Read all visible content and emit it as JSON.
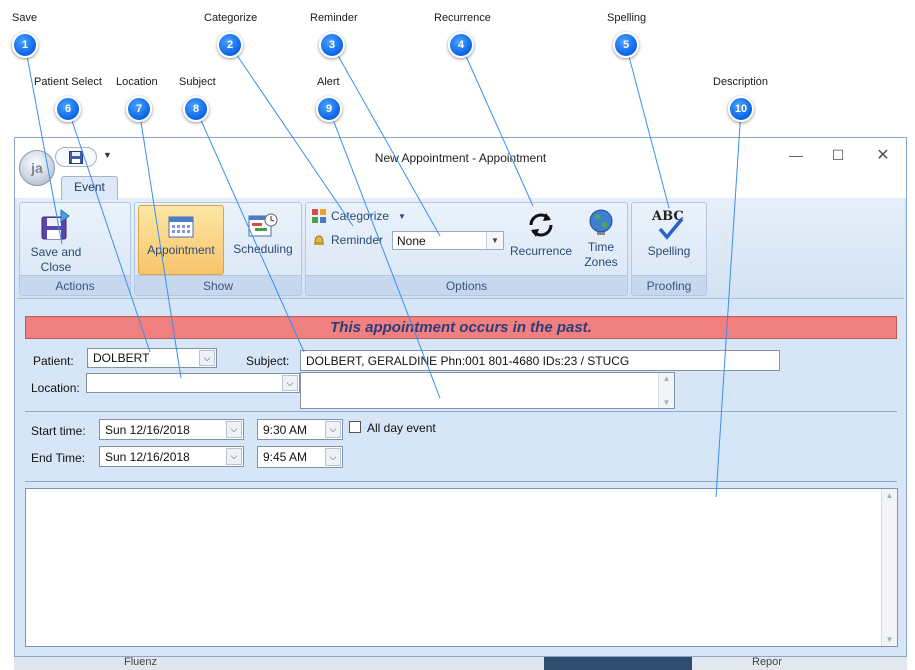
{
  "callouts": [
    {
      "n": "1",
      "label": "Save"
    },
    {
      "n": "2",
      "label": "Categorize"
    },
    {
      "n": "3",
      "label": "Reminder"
    },
    {
      "n": "4",
      "label": "Recurrence"
    },
    {
      "n": "5",
      "label": "Spelling"
    },
    {
      "n": "6",
      "label": "Patient Select"
    },
    {
      "n": "7",
      "label": "Location"
    },
    {
      "n": "8",
      "label": "Subject"
    },
    {
      "n": "9",
      "label": "Alert"
    },
    {
      "n": "10",
      "label": "Description"
    }
  ],
  "window": {
    "title": "New Appointment - Appointment",
    "orb_text": "ja",
    "tab": "Event"
  },
  "ribbon": {
    "actions": {
      "label": "Actions",
      "save_close_line1": "Save and",
      "save_close_line2": "Close"
    },
    "show": {
      "label": "Show",
      "appointment": "Appointment",
      "scheduling": "Scheduling"
    },
    "options": {
      "label": "Options",
      "categorize": "Categorize",
      "reminder": "Reminder",
      "reminder_value": "None",
      "recurrence": "Recurrence",
      "time_zones_line1": "Time",
      "time_zones_line2": "Zones"
    },
    "proofing": {
      "label": "Proofing",
      "spelling": "Spelling",
      "abc": "ABC"
    }
  },
  "banner": "This appointment occurs in the past.",
  "form": {
    "patient_label": "Patient:",
    "patient_value": "DOLBERT",
    "location_label": "Location:",
    "location_value": "",
    "subject_label": "Subject:",
    "subject_value": "DOLBERT, GERALDINE Phn:001 801-4680  IDs:23 / STUCG",
    "alert_value": "",
    "start_label": "Start time:",
    "start_date": "Sun 12/16/2018",
    "start_time": "9:30 AM",
    "end_label": "End Time:",
    "end_date": "Sun 12/16/2018",
    "end_time": "9:45 AM",
    "all_day_label": "All day event",
    "all_day_checked": false,
    "description_value": ""
  },
  "background_fragments": {
    "left": "Fluenz",
    "right": "Repor"
  },
  "colors": {
    "badge": "#0a64e6",
    "banner": "#f08080",
    "banner_text": "#2d3d7a",
    "selected_button": "#f7c56a",
    "window_bg": "#d7e6f7"
  }
}
